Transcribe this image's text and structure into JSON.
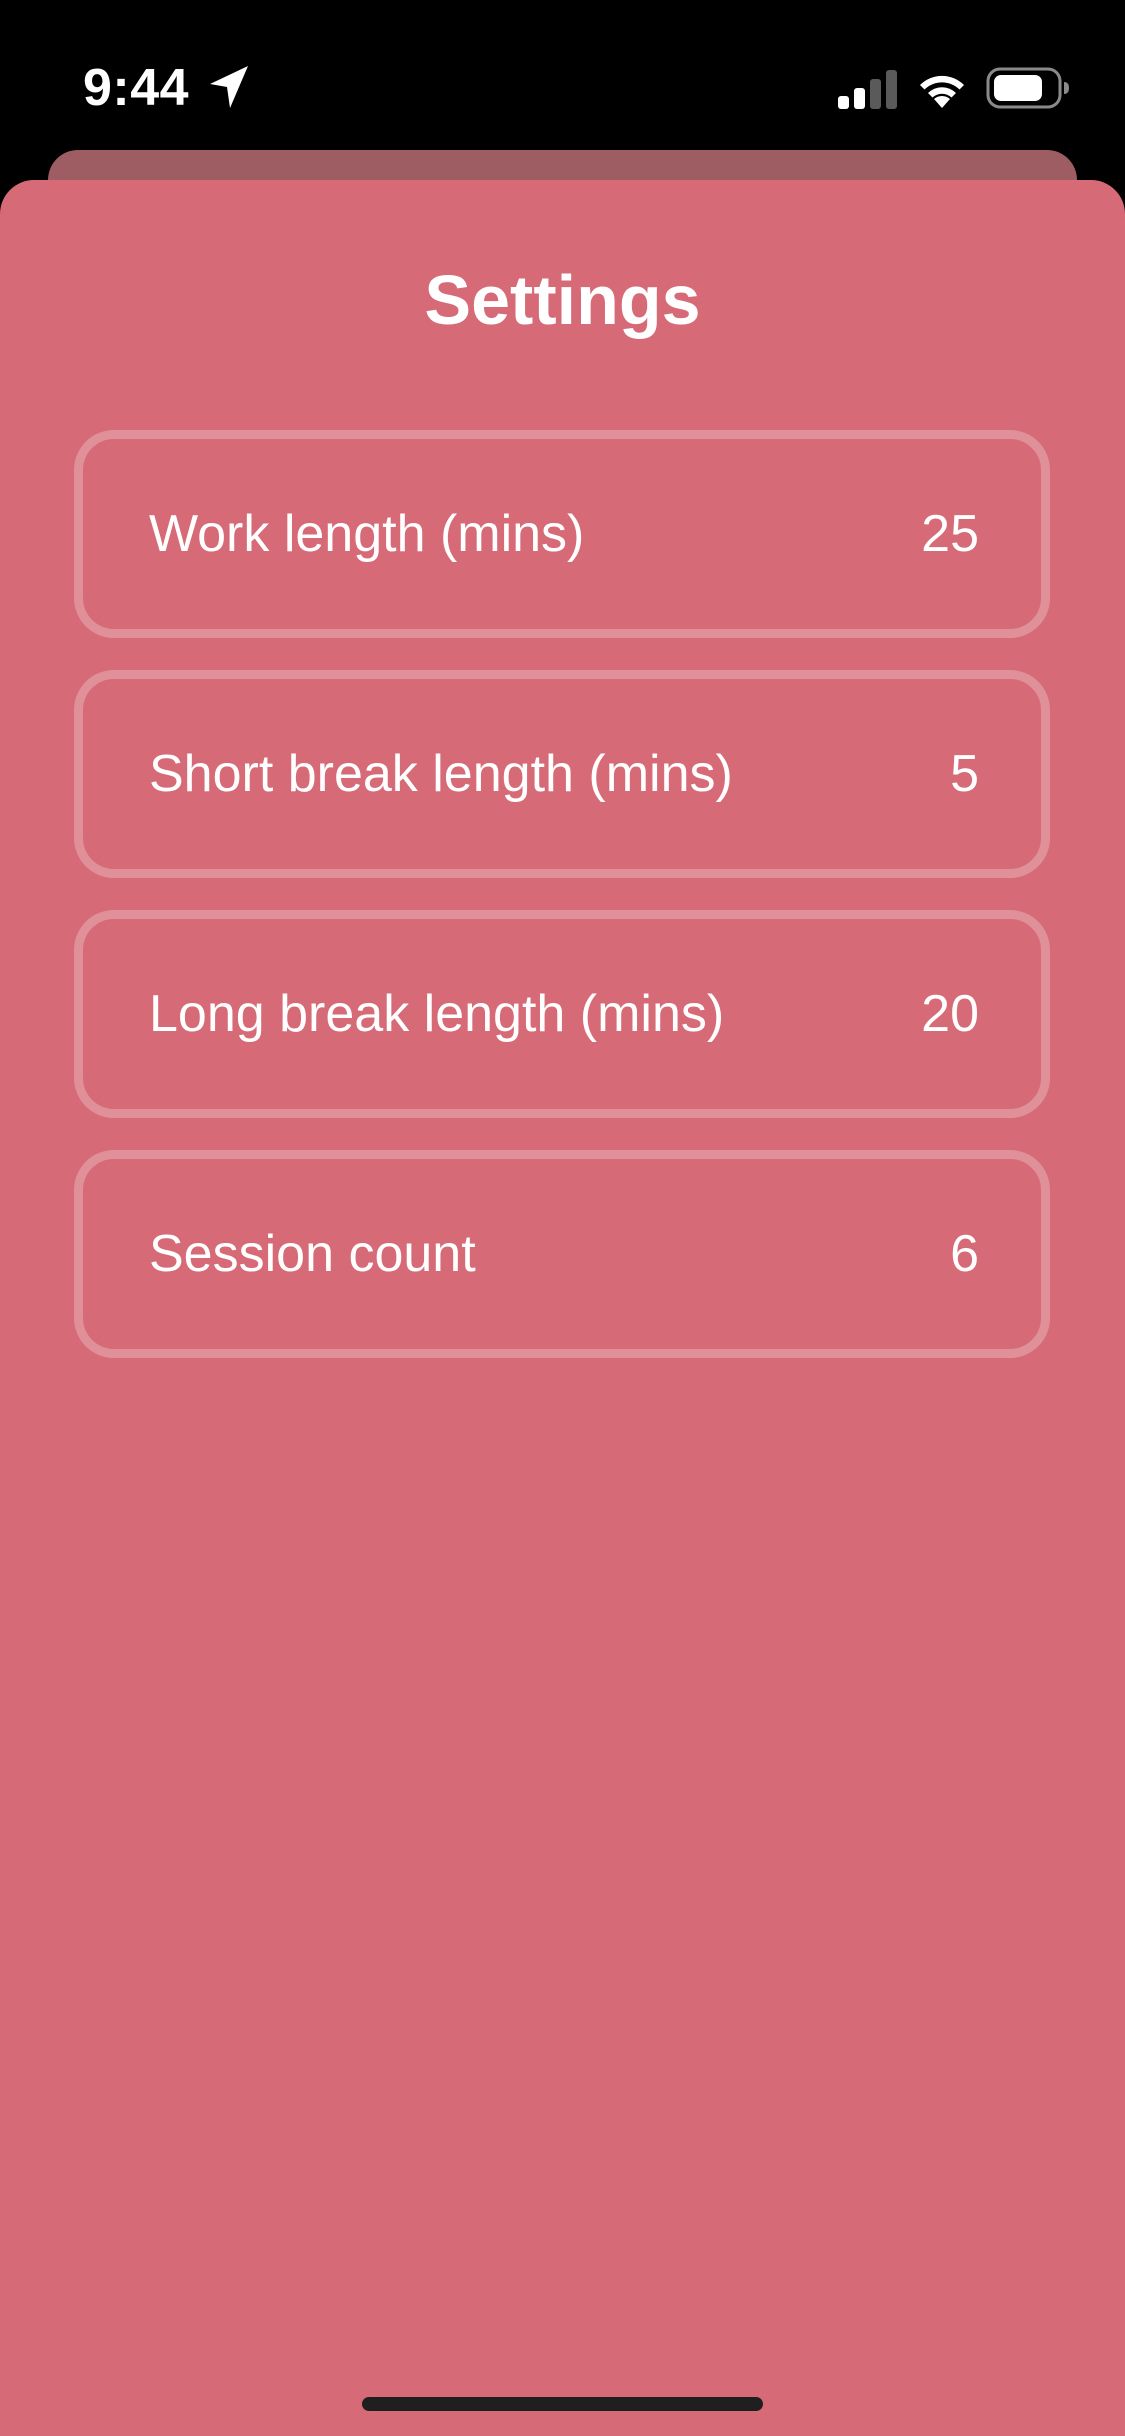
{
  "status_bar": {
    "time": "9:44",
    "location_icon": "location-arrow-icon",
    "signal_icon": "cellular-signal-icon",
    "wifi_icon": "wifi-icon",
    "battery_icon": "battery-icon"
  },
  "settings": {
    "title": "Settings",
    "items": [
      {
        "label": "Work length (mins)",
        "value": "25"
      },
      {
        "label": "Short break length (mins)",
        "value": "5"
      },
      {
        "label": "Long break length (mins)",
        "value": "20"
      },
      {
        "label": "Session count",
        "value": "6"
      }
    ]
  },
  "colors": {
    "sheet_background": "#d66b77",
    "sheet_back": "#9d5d63",
    "status_bar_background": "#000000",
    "text": "#ffffff"
  }
}
